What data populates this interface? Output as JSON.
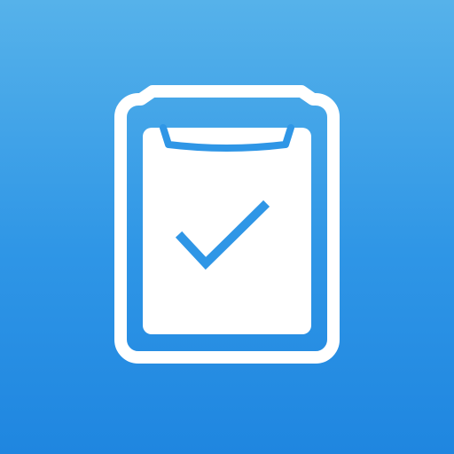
{
  "app_icon": {
    "icon_name": "clipboard-check-icon",
    "colors": {
      "background_top": "#56b2ea",
      "background_bottom": "#1f86e0",
      "glyph_white": "#ffffff",
      "glyph_accent": "#2f96e6"
    }
  }
}
